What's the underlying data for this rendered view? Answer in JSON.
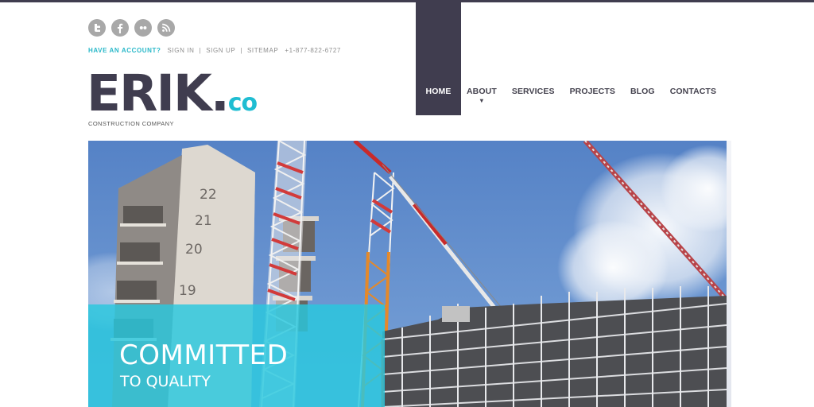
{
  "colors": {
    "brand_dark": "#403d4f",
    "accent_cyan": "#1fbdd2",
    "caption_bg": "#28c8de",
    "social_icon_bg": "#a8a8a8"
  },
  "social": [
    {
      "name": "twitter",
      "icon": "twitter-icon"
    },
    {
      "name": "facebook",
      "icon": "facebook-icon"
    },
    {
      "name": "flickr",
      "icon": "flickr-icon"
    },
    {
      "name": "rss",
      "icon": "rss-icon"
    }
  ],
  "account_bar": {
    "prompt": "HAVE AN ACCOUNT?",
    "sign_in": "SIGN IN",
    "sep1": "|",
    "sign_up": "SIGN UP",
    "sep2": "|",
    "sitemap": "SITEMAP",
    "phone": "+1-877-822-6727"
  },
  "logo": {
    "name": "ERIK",
    "dot": ".",
    "suffix": "co",
    "tagline": "CONSTRUCTION COMPANY"
  },
  "nav": {
    "items": [
      {
        "label": "HOME",
        "active": true
      },
      {
        "label": "ABOUT",
        "has_dropdown": true,
        "chevron": "⌄"
      },
      {
        "label": "SERVICES"
      },
      {
        "label": "PROJECTS"
      },
      {
        "label": "BLOG"
      },
      {
        "label": "CONTACTS"
      }
    ]
  },
  "hero": {
    "image_alt": "Construction site with tower cranes and scaffolding",
    "floor_numbers": [
      "22",
      "21",
      "20",
      "19"
    ],
    "caption_title": "COMMITTED",
    "caption_subtitle": "TO QUALITY"
  }
}
